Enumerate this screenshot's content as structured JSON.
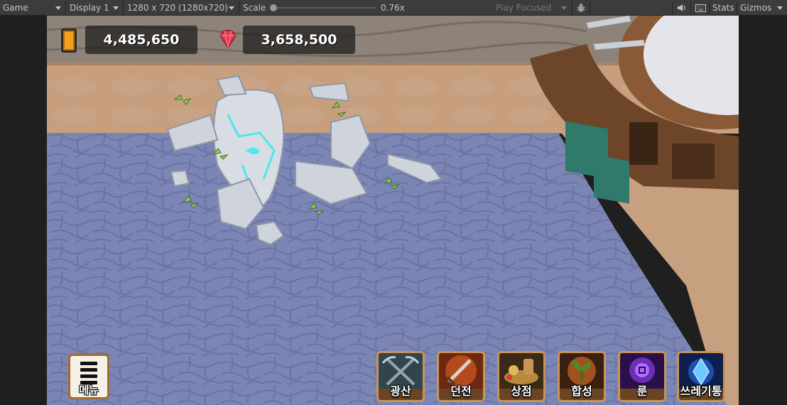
{
  "toolbar": {
    "view_mode": "Game",
    "display": "Display 1",
    "resolution": "1280 x 720 (1280x720)",
    "scale_label": "Scale",
    "scale_value": "0.76x",
    "play_mode": "Play Focused",
    "stats_label": "Stats",
    "gizmos_label": "Gizmos"
  },
  "hud": {
    "gold": "4,485,650",
    "gems": "3,658,500",
    "gold_icon": "gold-card-icon",
    "gem_icon": "ruby-gem-icon"
  },
  "menu": {
    "label": "메뉴",
    "icon": "hamburger-icon"
  },
  "skills": [
    {
      "label": "광산",
      "icon": "crossed-pickaxes-icon"
    },
    {
      "label": "던전",
      "icon": "sword-icon"
    },
    {
      "label": "상점",
      "icon": "treasure-pile-icon"
    },
    {
      "label": "합성",
      "icon": "sprout-icon"
    },
    {
      "label": "룬",
      "icon": "rune-hand-icon"
    },
    {
      "label": "쓰레기통",
      "icon": "blue-crystal-icon"
    }
  ]
}
